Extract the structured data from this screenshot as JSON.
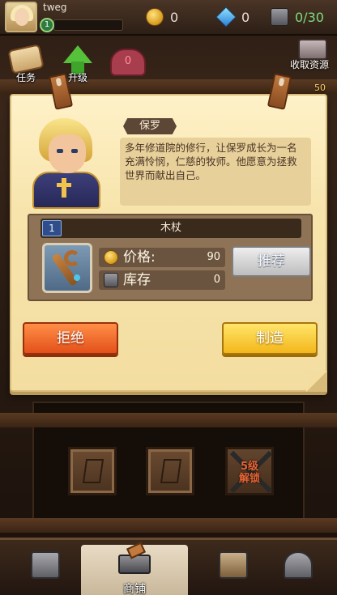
{
  "player": {
    "name": "tweg",
    "level": "1"
  },
  "resources": {
    "gold": "0",
    "gems": "0",
    "storage": "0/30"
  },
  "top_actions": {
    "task_label": "任务",
    "upgrade_label": "升级",
    "heart_count": "0",
    "collect_label": "收取资源",
    "side_value": "50"
  },
  "dialog": {
    "hero_name": "保罗",
    "description": "多年修道院的修行，让保罗成长为一名充满怜悯，仁慈的牧师。他愿意为拯救世界而献出自己。",
    "item": {
      "slot_number": "1",
      "name": "木杖"
    },
    "price_label": "价格:",
    "price_value": "90",
    "stock_label": "库存",
    "stock_value": "0",
    "recommend_label": "推荐",
    "refuse_label": "拒绝",
    "make_label": "制造"
  },
  "craft_slots": {
    "locked_text": "5级\n解锁"
  },
  "bottom_nav": {
    "shop_label": "商铺"
  },
  "colors": {
    "parchment": "#f7e4ac",
    "refuse": "#e3501a",
    "make": "#f3b71b",
    "accent_green": "#7fdc7a"
  }
}
